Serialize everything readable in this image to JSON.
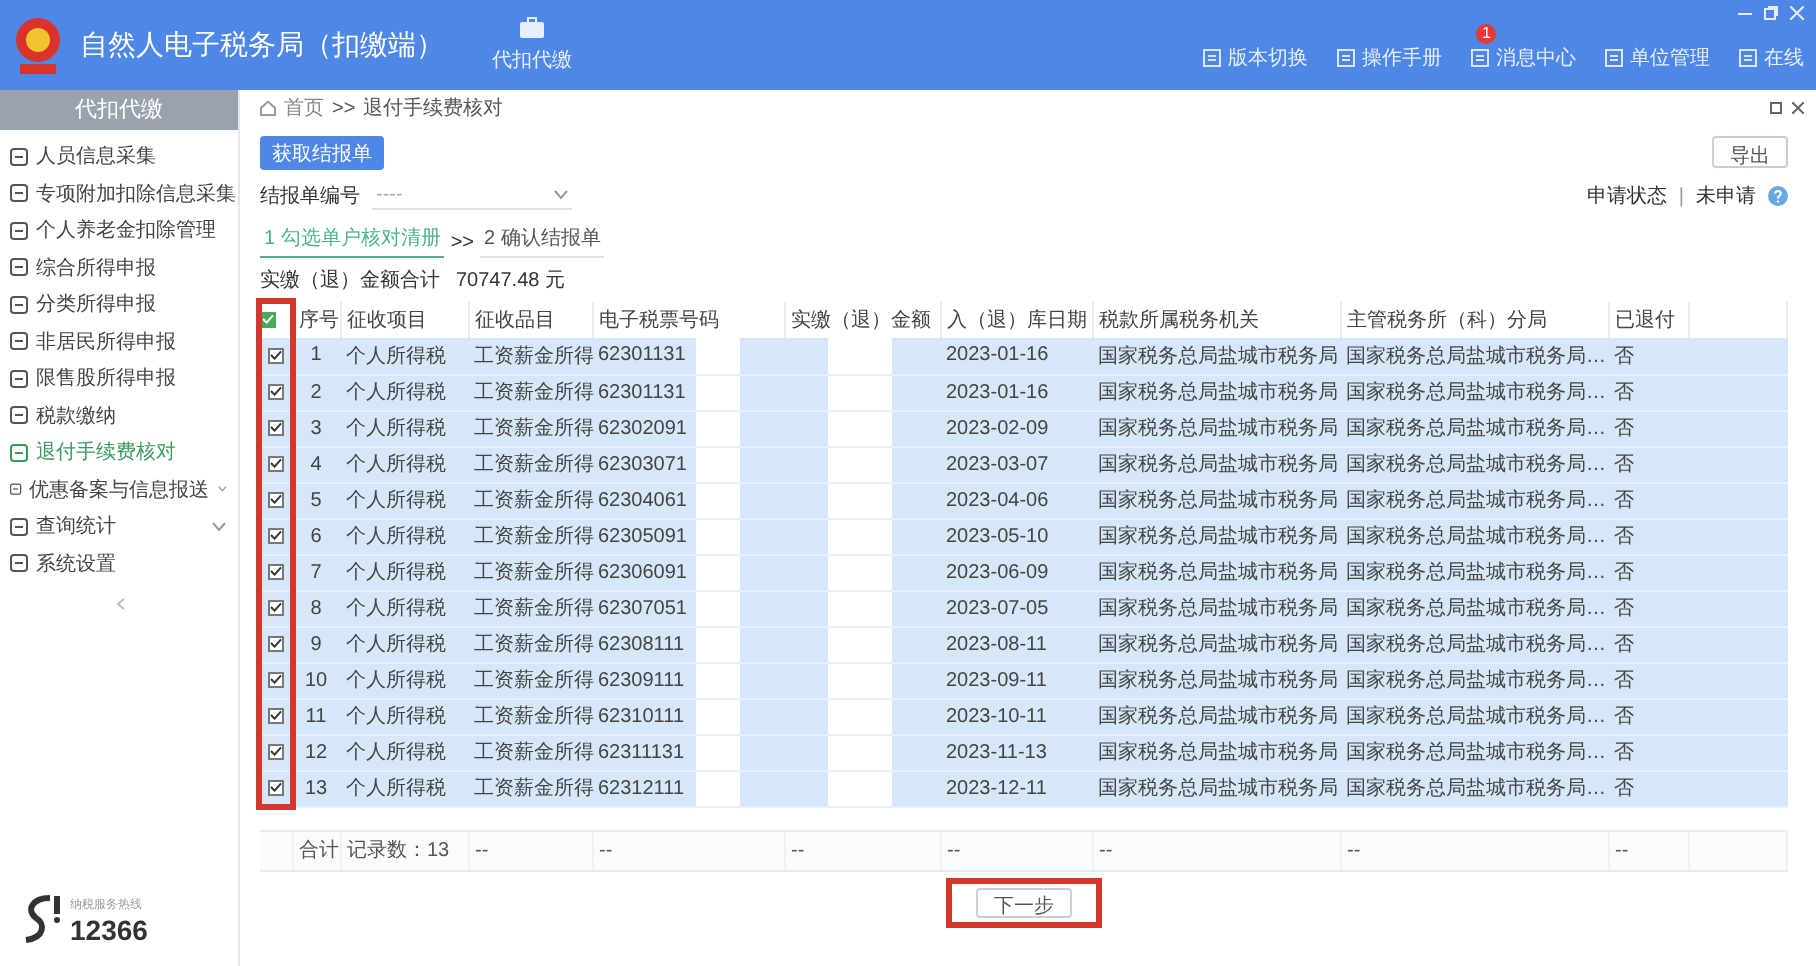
{
  "header": {
    "title": "自然人电子税务局（扣缴端）",
    "toolbar_button": {
      "label": "代扣代缴"
    },
    "links": [
      {
        "label": "版本切换"
      },
      {
        "label": "操作手册"
      },
      {
        "label": "消息中心",
        "badge": "1"
      },
      {
        "label": "单位管理"
      },
      {
        "label": "在线"
      }
    ]
  },
  "sidebar": {
    "title": "代扣代缴",
    "items": [
      {
        "label": "人员信息采集",
        "selected": false,
        "expandable": false
      },
      {
        "label": "专项附加扣除信息采集",
        "selected": false,
        "expandable": false
      },
      {
        "label": "个人养老金扣除管理",
        "selected": false,
        "expandable": false
      },
      {
        "label": "综合所得申报",
        "selected": false,
        "expandable": false
      },
      {
        "label": "分类所得申报",
        "selected": false,
        "expandable": false
      },
      {
        "label": "非居民所得申报",
        "selected": false,
        "expandable": false
      },
      {
        "label": "限售股所得申报",
        "selected": false,
        "expandable": false
      },
      {
        "label": "税款缴纳",
        "selected": false,
        "expandable": false
      },
      {
        "label": "退付手续费核对",
        "selected": true,
        "expandable": false
      },
      {
        "label": "优惠备案与信息报送",
        "selected": false,
        "expandable": true
      },
      {
        "label": "查询统计",
        "selected": false,
        "expandable": true
      },
      {
        "label": "系统设置",
        "selected": false,
        "expandable": false
      }
    ],
    "footer": {
      "caption": "纳税服务热线",
      "number": "12366"
    }
  },
  "breadcrumb": {
    "home": "首页",
    "separator": ">>",
    "current": "退付手续费核对"
  },
  "fetch_button": "获取结报单",
  "export_button": "导出",
  "filter": {
    "label": "结报单编号",
    "placeholder": "----"
  },
  "status": {
    "label": "申请状态",
    "separator": "|",
    "value": "未申请"
  },
  "steps": [
    {
      "label": "1 勾选单户核对清册",
      "selected": true
    },
    {
      "label": "2 确认结报单",
      "selected": false
    }
  ],
  "steps_separator": ">>",
  "total": {
    "label": "实缴（退）金额合计",
    "value": "70747.48 元"
  },
  "table": {
    "checkbox_column_highlighted": true,
    "all_checked": true,
    "columns": [
      "序号",
      "征收项目",
      "征收品目",
      "电子税票号码",
      "实缴（退）金额",
      "入（退）库日期",
      "税款所属税务机关",
      "主管税务所（科）分局",
      "已退付"
    ],
    "rows": [
      {
        "checked": true,
        "seq": "1",
        "item": "个人所得税",
        "subitem": "工资薪金所得",
        "ticket": "62301131",
        "date": "2023-01-16",
        "authority": "国家税务总局盐城市税务局",
        "branch": "国家税务总局盐城市税务局…",
        "refunded": "否"
      },
      {
        "checked": true,
        "seq": "2",
        "item": "个人所得税",
        "subitem": "工资薪金所得",
        "ticket": "62301131",
        "date": "2023-01-16",
        "authority": "国家税务总局盐城市税务局",
        "branch": "国家税务总局盐城市税务局…",
        "refunded": "否"
      },
      {
        "checked": true,
        "seq": "3",
        "item": "个人所得税",
        "subitem": "工资薪金所得",
        "ticket": "62302091",
        "date": "2023-02-09",
        "authority": "国家税务总局盐城市税务局",
        "branch": "国家税务总局盐城市税务局…",
        "refunded": "否"
      },
      {
        "checked": true,
        "seq": "4",
        "item": "个人所得税",
        "subitem": "工资薪金所得",
        "ticket": "62303071",
        "date": "2023-03-07",
        "authority": "国家税务总局盐城市税务局",
        "branch": "国家税务总局盐城市税务局…",
        "refunded": "否"
      },
      {
        "checked": true,
        "seq": "5",
        "item": "个人所得税",
        "subitem": "工资薪金所得",
        "ticket": "62304061",
        "date": "2023-04-06",
        "authority": "国家税务总局盐城市税务局",
        "branch": "国家税务总局盐城市税务局…",
        "refunded": "否"
      },
      {
        "checked": true,
        "seq": "6",
        "item": "个人所得税",
        "subitem": "工资薪金所得",
        "ticket": "62305091",
        "date": "2023-05-10",
        "authority": "国家税务总局盐城市税务局",
        "branch": "国家税务总局盐城市税务局…",
        "refunded": "否"
      },
      {
        "checked": true,
        "seq": "7",
        "item": "个人所得税",
        "subitem": "工资薪金所得",
        "ticket": "62306091",
        "date": "2023-06-09",
        "authority": "国家税务总局盐城市税务局",
        "branch": "国家税务总局盐城市税务局…",
        "refunded": "否"
      },
      {
        "checked": true,
        "seq": "8",
        "item": "个人所得税",
        "subitem": "工资薪金所得",
        "ticket": "62307051",
        "date": "2023-07-05",
        "authority": "国家税务总局盐城市税务局",
        "branch": "国家税务总局盐城市税务局…",
        "refunded": "否"
      },
      {
        "checked": true,
        "seq": "9",
        "item": "个人所得税",
        "subitem": "工资薪金所得",
        "ticket": "62308111",
        "date": "2023-08-11",
        "authority": "国家税务总局盐城市税务局",
        "branch": "国家税务总局盐城市税务局…",
        "refunded": "否"
      },
      {
        "checked": true,
        "seq": "10",
        "item": "个人所得税",
        "subitem": "工资薪金所得",
        "ticket": "62309111",
        "date": "2023-09-11",
        "authority": "国家税务总局盐城市税务局",
        "branch": "国家税务总局盐城市税务局…",
        "refunded": "否"
      },
      {
        "checked": true,
        "seq": "11",
        "item": "个人所得税",
        "subitem": "工资薪金所得",
        "ticket": "62310111",
        "date": "2023-10-11",
        "authority": "国家税务总局盐城市税务局",
        "branch": "国家税务总局盐城市税务局…",
        "refunded": "否"
      },
      {
        "checked": true,
        "seq": "12",
        "item": "个人所得税",
        "subitem": "工资薪金所得",
        "ticket": "62311131",
        "date": "2023-11-13",
        "authority": "国家税务总局盐城市税务局",
        "branch": "国家税务总局盐城市税务局…",
        "refunded": "否"
      },
      {
        "checked": true,
        "seq": "13",
        "item": "个人所得税",
        "subitem": "工资薪金所得",
        "ticket": "62312111",
        "date": "2023-12-11",
        "authority": "国家税务总局盐城市税务局",
        "branch": "国家税务总局盐城市税务局…",
        "refunded": "否"
      }
    ],
    "footer": {
      "label": "合计",
      "count": "记录数：13",
      "dashes": [
        "--",
        "--",
        "--",
        "--",
        "--",
        "--",
        "--"
      ]
    }
  },
  "next_button": {
    "label": "下一步",
    "highlighted": true
  }
}
